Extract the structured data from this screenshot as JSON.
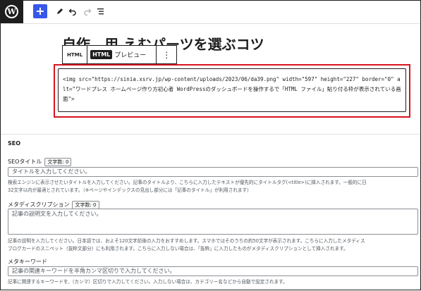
{
  "toolbar": {
    "logo_glyph": "W",
    "add_glyph": "+",
    "tools_icon": "pencil-icon",
    "undo_icon": "undo-icon",
    "redo_icon": "redo-icon",
    "listview_icon": "list-view-icon"
  },
  "editor": {
    "title": "自作…用 えむパーツを選ぶコツ",
    "block_toolbar": {
      "type_label": "HTML",
      "tab_html": "HTML",
      "tab_preview": "プレビュー",
      "more_glyph": "⋮"
    },
    "html_code": "<img src=\"https://sinia.xsrv.jp/wp-content/uploads/2023/06/da39.png\" width=\"597\" height=\"227\" border=\"0\" alt=\"ワードプレス ホームページ作り方初心者 WordPressのダッシュボードを操作するで「HTML ファイル」貼り付る枠が表示されている画面\">"
  },
  "seo": {
    "heading": "SEO",
    "title_label": "SEOタイトル",
    "title_count": "文字数: 0",
    "title_placeholder": "タイトルを入力してください。",
    "title_help_1": "検索エンジンに表示させたいタイトルを入力してください。記事のタイトルより、こちらに入力したテキストが優先的にタイトルタグ(<title>)に挿入されます。一般的に日",
    "title_help_2": "32文字以内が最適とされています。（※ページやインデックスの見出し部分には「記事のタイトル」が利用されます）",
    "desc_label": "メタディスクリプション",
    "desc_count": "文字数: 0",
    "desc_placeholder": "記事の説明文を入力してください。",
    "desc_help_1": "記事の説明を入力してください。日本語では、およそ120文字前後の入力をおすすめします。スマホではそのうちの約50文字が表示されます。こちらに入力したメタディス",
    "desc_help_2": "ブログカードのスニペット（抜粋文部分）にも利用されます。こちらに入力しない場合は、「抜粋」に入力したものがメタディスクリプションとして挿入されます。",
    "keyword_label": "メタキーワード",
    "keyword_placeholder": "記事の関連キーワードを半角カンマ区切りで入力してください。",
    "keyword_help": "記事に関連するキーワードを,（カンマ）区切りで入力してください。入力しない場合は、カテゴリー名などから自動で設定されます。"
  },
  "colors": {
    "accent": "#3858e9",
    "highlight": "#d6151f",
    "dark": "#1e1e1e"
  }
}
